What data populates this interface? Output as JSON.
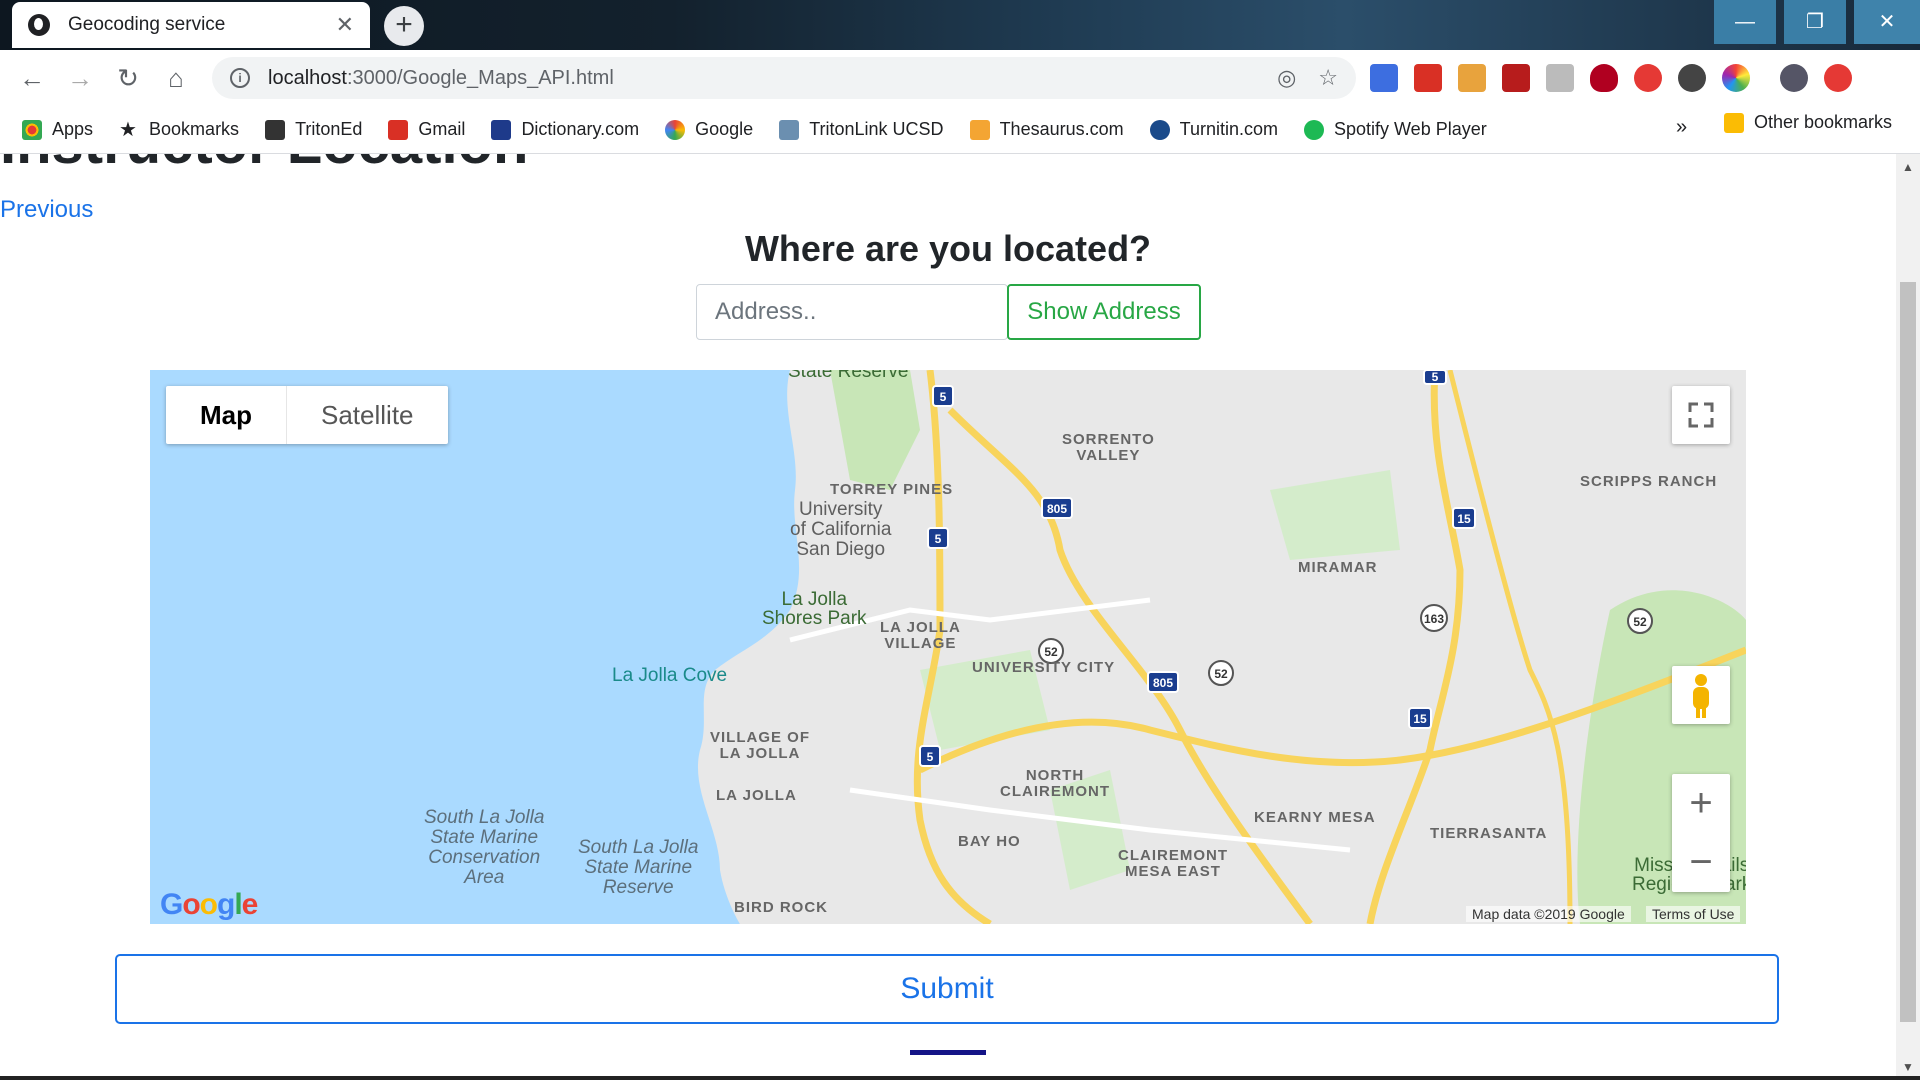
{
  "browser": {
    "tab_title": "Geocoding service",
    "url_host": "localhost",
    "url_path": ":3000/Google_Maps_API.html",
    "bookmarks": [
      "Apps",
      "Bookmarks",
      "TritonEd",
      "Gmail",
      "Dictionary.com",
      "Google",
      "TritonLink UCSD",
      "Thesaurus.com",
      "Turnitin.com",
      "Spotify Web Player"
    ],
    "more": "»",
    "other_bookmarks": "Other bookmarks"
  },
  "page": {
    "heading": "Instructor Location",
    "previous_link": "Previous",
    "question": "Where are you located?",
    "address_placeholder": "Address..",
    "show_address_button": "Show Address",
    "submit_button": "Submit"
  },
  "map": {
    "type_map": "Map",
    "type_satellite": "Satellite",
    "data_credit": "Map data ©2019 Google",
    "terms": "Terms of Use",
    "logo": "Google",
    "places": {
      "state_reserve": "State Reserve",
      "sorrento_valley": "SORRENTO\nVALLEY",
      "scripps_ranch": "SCRIPPS RANCH",
      "torrey_pines": "TORREY PINES",
      "ucsd": "University\nof California\nSan Diego",
      "miramar": "MIRAMAR",
      "la_jolla_shores": "La Jolla\nShores Park",
      "la_jolla_village": "LA JOLLA\nVILLAGE",
      "university_city": "UNIVERSITY CITY",
      "la_jolla_cove": "La Jolla Cove",
      "village_of_la_jolla": "VILLAGE OF\nLA JOLLA",
      "north_clairemont": "NORTH\nCLAIREMONT",
      "la_jolla": "LA JOLLA",
      "kearny_mesa": "KEARNY MESA",
      "tierrasanta": "TIERRASANTA",
      "south_la_jolla_smca": "South La Jolla\nState Marine\nConservation\nArea",
      "south_la_jolla_smr": "South La Jolla\nState Marine\nReserve",
      "bay_ho": "BAY HO",
      "clairemont_mesa_east": "CLAIREMONT\nMESA EAST",
      "bird_rock": "BIRD ROCK",
      "mission_trails": "Mission Trails\nRegional Park"
    },
    "shields": [
      "5",
      "5",
      "5",
      "5",
      "805",
      "805",
      "15",
      "15",
      "15",
      "15",
      "163",
      "52",
      "52",
      "52"
    ]
  }
}
